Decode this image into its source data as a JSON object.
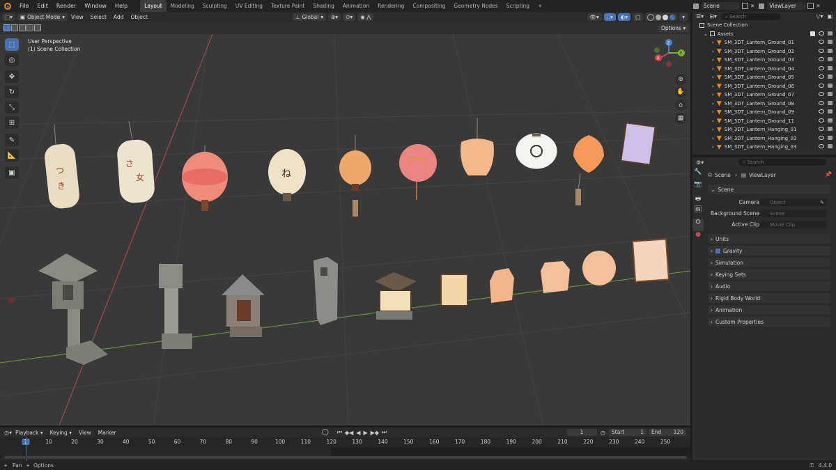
{
  "menubar": {
    "items": [
      "File",
      "Edit",
      "Render",
      "Window",
      "Help"
    ],
    "workspaces": [
      "Layout",
      "Modeling",
      "Sculpting",
      "UV Editing",
      "Texture Paint",
      "Shading",
      "Animation",
      "Rendering",
      "Compositing",
      "Geometry Nodes",
      "Scripting"
    ],
    "add_tab": "+",
    "scene": "Scene",
    "view_layer": "ViewLayer"
  },
  "viewport_header": {
    "mode": "Object Mode",
    "menus": [
      "View",
      "Select",
      "Add",
      "Object"
    ],
    "orientation": "Global",
    "options": "Options"
  },
  "viewport": {
    "perspective": "User Perspective",
    "collection": "(1) Scene Collection"
  },
  "outliner": {
    "search_placeholder": "Search",
    "root": "Scene Collection",
    "collection": "Assets",
    "items": [
      "SM_3DT_Lantern_Ground_01",
      "SM_3DT_Lantern_Ground_02",
      "SM_3DT_Lantern_Ground_03",
      "SM_3DT_Lantern_Ground_04",
      "SM_3DT_Lantern_Ground_05",
      "SM_3DT_Lantern_Ground_06",
      "SM_3DT_Lantern_Ground_07",
      "SM_3DT_Lantern_Ground_08",
      "SM_3DT_Lantern_Ground_09",
      "SM_3DT_Lantern_Ground_11",
      "SM_3DT_Lantern_Hanging_01",
      "SM_3DT_Lantern_Hanging_02",
      "SM_3DT_Lantern_Hanging_03"
    ]
  },
  "properties": {
    "search_placeholder": "Search",
    "breadcrumb": [
      "Scene",
      "ViewLayer"
    ],
    "scene_section": "Scene",
    "camera_label": "Camera",
    "camera_placeholder": "Object",
    "background_label": "Background Scene",
    "background_placeholder": "Scene",
    "clip_label": "Active Clip",
    "clip_placeholder": "Movie Clip",
    "sections": [
      "Units",
      "Gravity",
      "Simulation",
      "Keying Sets",
      "Audio",
      "Rigid Body World",
      "Animation",
      "Custom Properties"
    ]
  },
  "timeline": {
    "menus": [
      "Playback",
      "Keying",
      "View",
      "Marker"
    ],
    "current_frame": "1",
    "start_label": "Start",
    "start": "1",
    "end_label": "End",
    "end": "120",
    "ruler": [
      "1",
      "10",
      "20",
      "30",
      "40",
      "50",
      "60",
      "70",
      "80",
      "90",
      "100",
      "110",
      "120",
      "130",
      "140",
      "150",
      "160",
      "170",
      "180",
      "190",
      "200",
      "210",
      "220",
      "230",
      "240",
      "250"
    ]
  },
  "statusbar": {
    "pan": "Pan",
    "options": "Options",
    "version": "4.4.0"
  },
  "colors": {
    "accent": "#4772b3",
    "brand_orange": "#e88a2e",
    "x_axis": "#c9464e",
    "y_axis": "#7bb23a",
    "z_axis": "#3f7fd8"
  }
}
